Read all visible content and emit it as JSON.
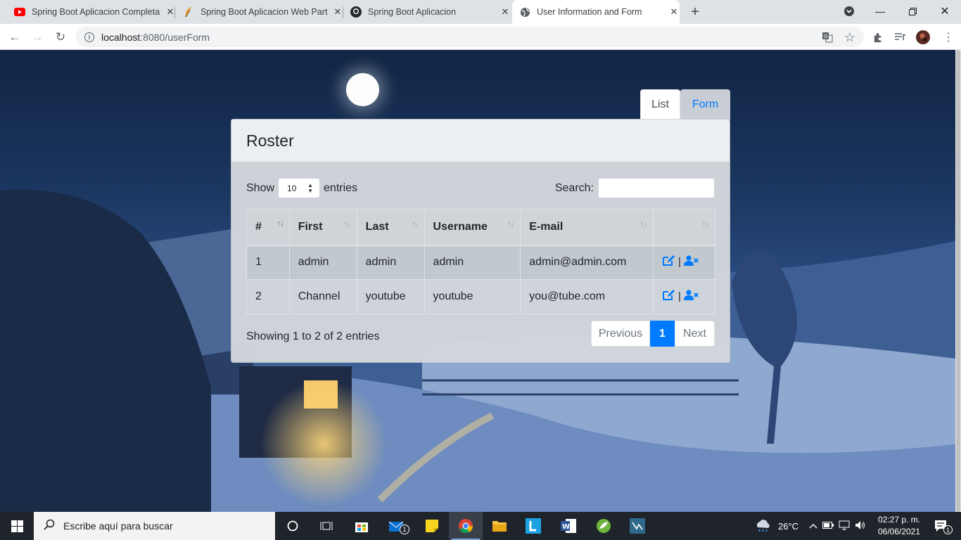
{
  "browser": {
    "tabs": [
      {
        "title": "Spring Boot Aplicacion Completa",
        "icon": "youtube-icon"
      },
      {
        "title": "Spring Boot Aplicacion Web Parte",
        "icon": "feather-icon"
      },
      {
        "title": "Spring Boot Aplicacion",
        "icon": "github-icon"
      },
      {
        "title": "User Information and Form",
        "icon": "globe-icon",
        "active": true
      }
    ],
    "url_host": "localhost",
    "url_path": ":8080/userForm"
  },
  "nav": {
    "list_label": "List",
    "form_label": "Form"
  },
  "card": {
    "title": "Roster",
    "length": {
      "show": "Show",
      "value": "10",
      "entries": "entries"
    },
    "search_label": "Search:",
    "columns": [
      "#",
      "First",
      "Last",
      "Username",
      "E-mail",
      ""
    ],
    "rows": [
      {
        "id": "1",
        "first": "admin",
        "last": "admin",
        "username": "admin",
        "email": "admin@admin.com"
      },
      {
        "id": "2",
        "first": "Channel",
        "last": "youtube",
        "username": "youtube",
        "email": "you@tube.com"
      }
    ],
    "action_separator": "|",
    "info": "Showing 1 to 2 of 2 entries",
    "pager": {
      "previous": "Previous",
      "current": "1",
      "next": "Next"
    }
  },
  "taskbar": {
    "search_placeholder": "Escribe aquí para buscar",
    "mail_badge": "1",
    "weather": "26°C",
    "time": "02:27 p. m.",
    "date": "06/06/2021",
    "notification_count": "1"
  },
  "colors": {
    "primary": "#007bff",
    "taskbar": "#1f242b"
  }
}
